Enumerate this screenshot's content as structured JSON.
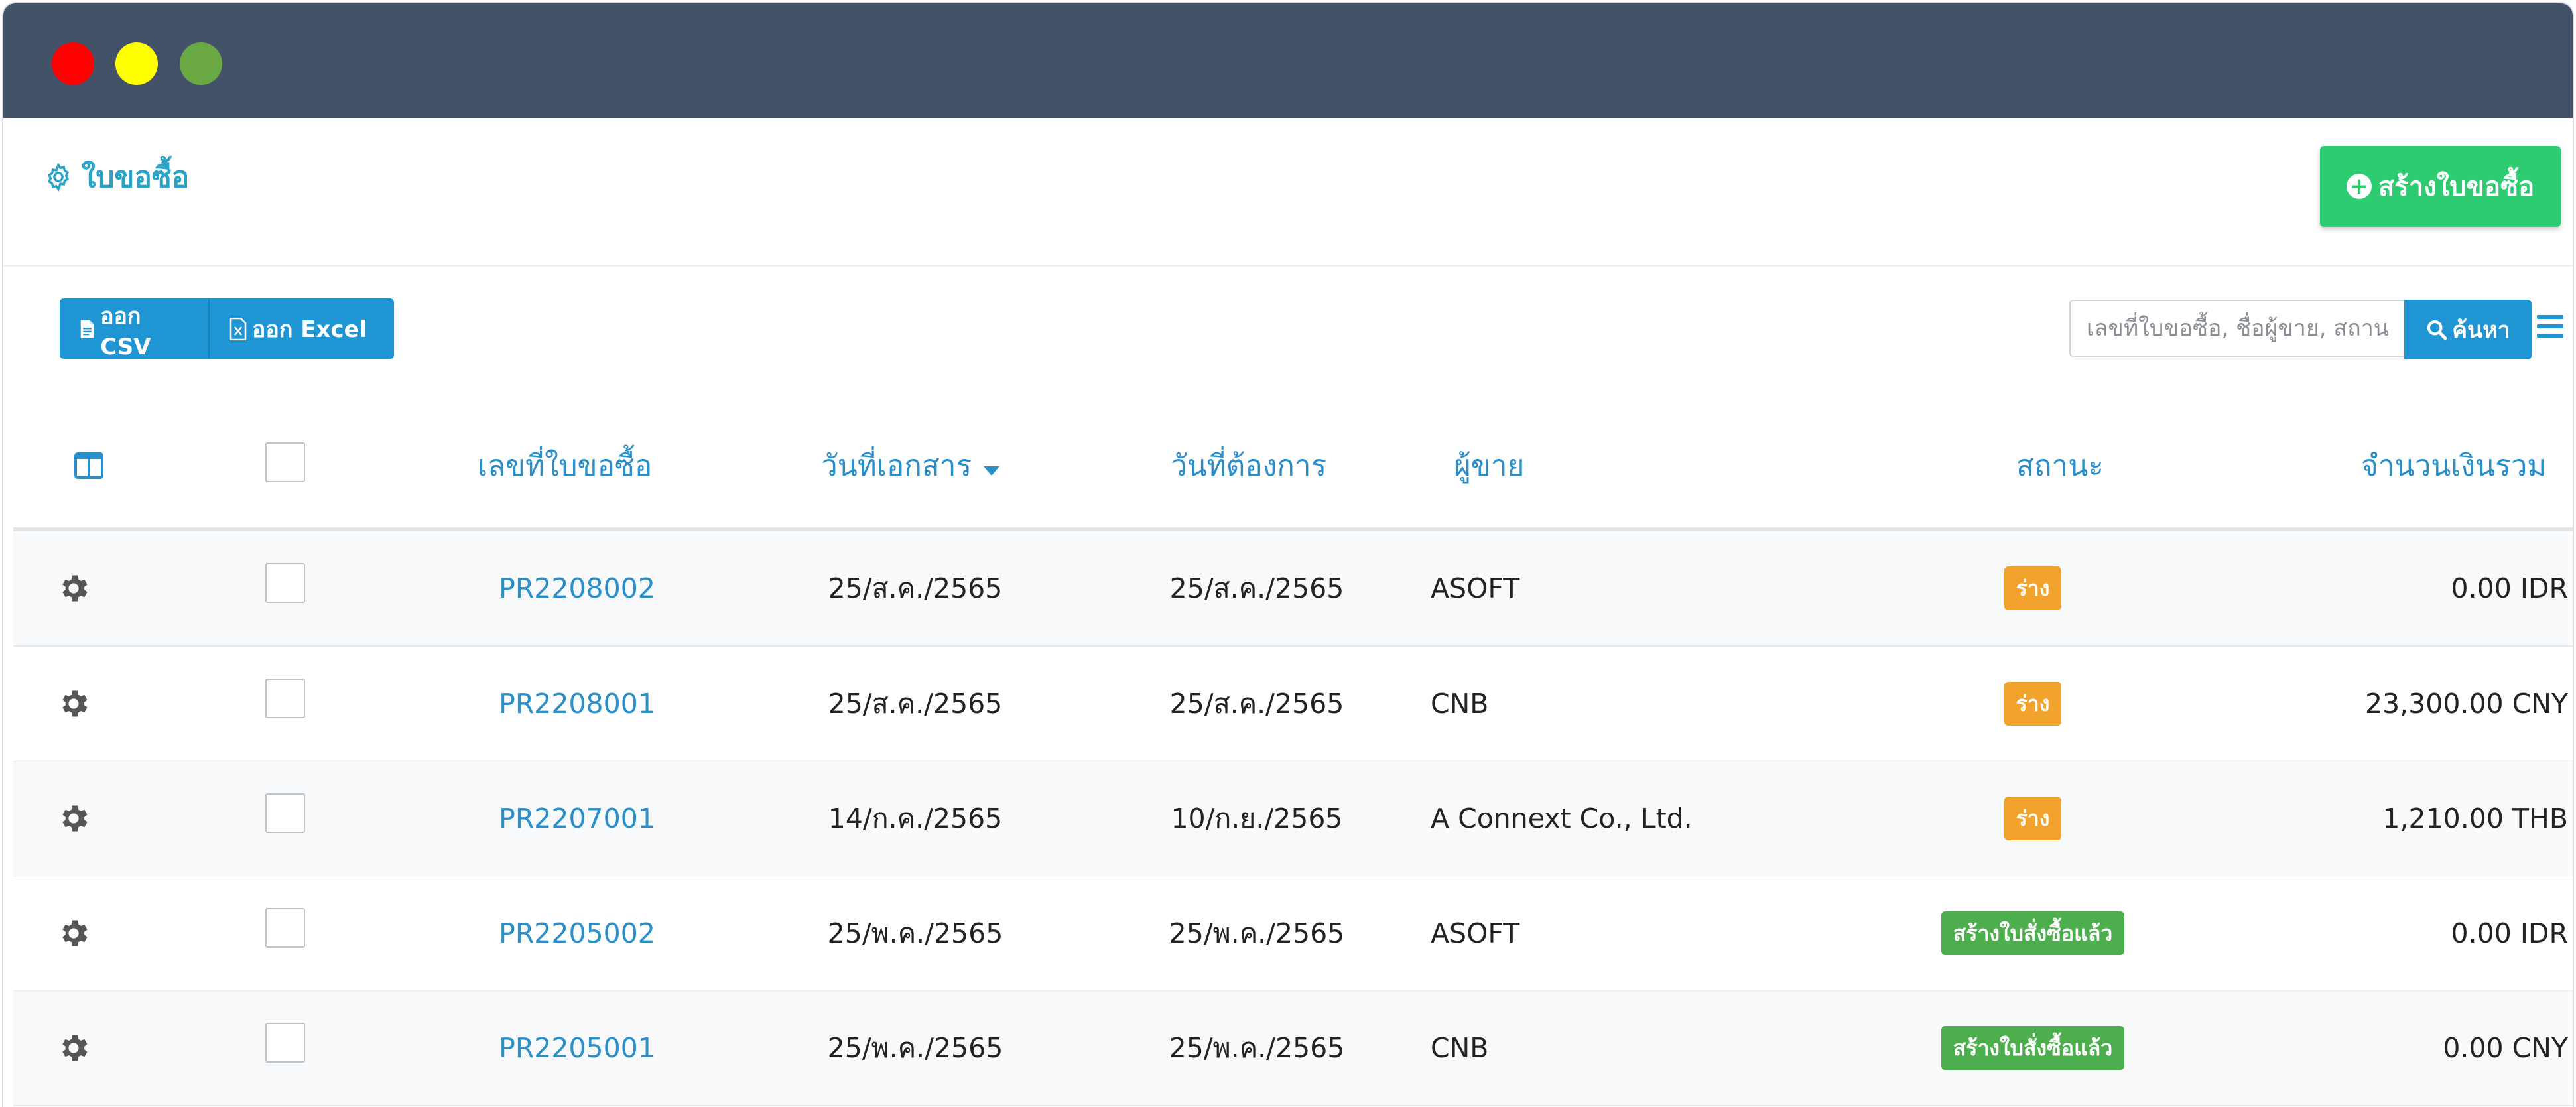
{
  "window": {
    "controls": {
      "close": "#ff0000",
      "minimize": "#ffff00",
      "maximize": "#6aa844"
    }
  },
  "page": {
    "title": "ใบขอซื้อ",
    "title_icon": "gear-outline-icon",
    "create_button": "สร้างใบขอซื้อ"
  },
  "toolbar": {
    "export_csv": "ออก CSV",
    "export_excel": "ออก Excel",
    "search_placeholder": "เลขที่ใบขอซื้อ, ชื่อผู้ขาย, สถานะ",
    "search_button": "ค้นหา"
  },
  "table": {
    "headers": {
      "doc_no": "เลขที่ใบขอซื้อ",
      "doc_date": "วันที่เอกสาร",
      "required_date": "วันที่ต้องการ",
      "vendor": "ผู้ขาย",
      "status": "สถานะ",
      "total": "จำนวนเงินรวม"
    },
    "sort_column": "doc_date",
    "rows": [
      {
        "doc_no": "PR2208002",
        "doc_date": "25/ส.ค./2565",
        "required_date": "25/ส.ค./2565",
        "vendor": "ASOFT",
        "status": "ร่าง",
        "status_type": "draft",
        "total": "0.00 IDR"
      },
      {
        "doc_no": "PR2208001",
        "doc_date": "25/ส.ค./2565",
        "required_date": "25/ส.ค./2565",
        "vendor": "CNB",
        "status": "ร่าง",
        "status_type": "draft",
        "total": "23,300.00 CNY"
      },
      {
        "doc_no": "PR2207001",
        "doc_date": "14/ก.ค./2565",
        "required_date": "10/ก.ย./2565",
        "vendor": "A Connext Co., Ltd.",
        "status": "ร่าง",
        "status_type": "draft",
        "total": "1,210.00 THB"
      },
      {
        "doc_no": "PR2205002",
        "doc_date": "25/พ.ค./2565",
        "required_date": "25/พ.ค./2565",
        "vendor": "ASOFT",
        "status": "สร้างใบสั่งซื้อแล้ว",
        "status_type": "done",
        "total": "0.00 IDR"
      },
      {
        "doc_no": "PR2205001",
        "doc_date": "25/พ.ค./2565",
        "required_date": "25/พ.ค./2565",
        "vendor": "CNB",
        "status": "สร้างใบสั่งซื้อแล้ว",
        "status_type": "done",
        "total": "0.00 CNY"
      }
    ]
  },
  "colors": {
    "titlebar": "#435269",
    "accent": "#1f95d4",
    "create": "#2ecc71",
    "draft_badge": "#f0a22c",
    "done_badge": "#4cae4c"
  }
}
